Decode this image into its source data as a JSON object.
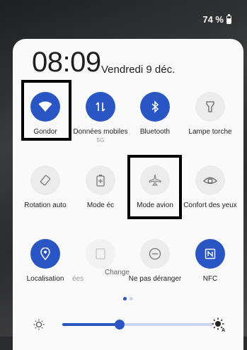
{
  "status": {
    "battery": "74 %"
  },
  "header": {
    "time": "08:09",
    "date": "Vendredi 9 déc."
  },
  "tiles": [
    {
      "label": "Gondor",
      "sub": "",
      "icon": "wifi-icon",
      "state": "on"
    },
    {
      "label": "Données mobiles",
      "sub": "5G",
      "icon": "mobile-data-icon",
      "state": "on"
    },
    {
      "label": "Bluetooth",
      "sub": "",
      "icon": "bluetooth-icon",
      "state": "on"
    },
    {
      "label": "Lampe torche",
      "sub": "",
      "icon": "flashlight-icon",
      "state": "off"
    },
    {
      "label": "Rotation auto",
      "sub": "",
      "icon": "rotate-icon",
      "state": "off"
    },
    {
      "label": "Mode éc",
      "sub": "",
      "icon": "battery-saver-icon",
      "state": "off"
    },
    {
      "label": "Mode avion",
      "sub": "",
      "icon": "airplane-icon",
      "state": "off"
    },
    {
      "label": "Confort des yeux",
      "sub": "",
      "icon": "eye-comfort-icon",
      "state": "off"
    },
    {
      "label": "Localisation",
      "sub": "",
      "icon": "location-icon",
      "state": "on"
    },
    {
      "label": "ées",
      "sub": "",
      "icon": "data-saver-icon",
      "state": "off"
    },
    {
      "label": "Change",
      "sub": "",
      "icon": "dnd-icon",
      "state": "off"
    },
    {
      "label": "Ne pas déranger",
      "sub": "",
      "icon": "do-not-disturb-icon",
      "state": "off"
    },
    {
      "label": "NFC",
      "sub": "",
      "icon": "nfc-icon",
      "state": "on"
    }
  ],
  "pager": {
    "pages": 2,
    "current": 1
  },
  "brightness": {
    "level": 0.38
  },
  "colors": {
    "accent": "#2a56c4",
    "tile_off": "#ececec",
    "panel": "#fafafa"
  }
}
